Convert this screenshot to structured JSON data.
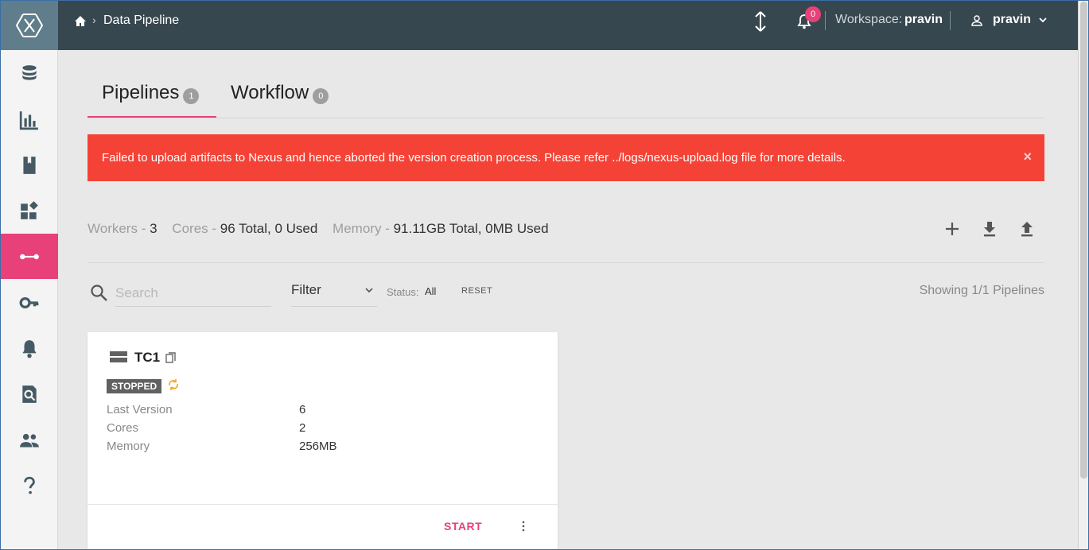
{
  "header": {
    "breadcrumb_sep": "›",
    "breadcrumb": "Data Pipeline",
    "notification_count": "0",
    "workspace_label": "Workspace:",
    "workspace_value": "pravin",
    "user_name": "pravin"
  },
  "sidebar": {
    "items": [
      {
        "icon": "database-icon"
      },
      {
        "icon": "bar-chart-icon"
      },
      {
        "icon": "book-icon"
      },
      {
        "icon": "dashboard-widgets-icon"
      },
      {
        "icon": "pipeline-icon",
        "active": true
      },
      {
        "icon": "key-icon"
      },
      {
        "icon": "bell-icon"
      },
      {
        "icon": "search-document-icon"
      },
      {
        "icon": "people-icon"
      },
      {
        "icon": "help-icon"
      }
    ]
  },
  "tabs": [
    {
      "label": "Pipelines",
      "count": "1",
      "active": true
    },
    {
      "label": "Workflow",
      "count": "0",
      "active": false
    }
  ],
  "error": {
    "message": "Failed to upload artifacts to Nexus and hence aborted the version creation process. Please refer ../logs/nexus-upload.log file for more details.",
    "close": "×"
  },
  "stats": {
    "workers_label": "Workers -",
    "workers_value": "3",
    "cores_label": "Cores -",
    "cores_value": "96 Total, 0 Used",
    "memory_label": "Memory -",
    "memory_value": "91.11GB Total, 0MB Used"
  },
  "filters": {
    "search_placeholder": "Search",
    "filter_label": "Filter",
    "status_label": "Status:",
    "status_value": "All",
    "reset_label": "RESET",
    "showing": "Showing 1/1 Pipelines"
  },
  "pipeline_card": {
    "name": "TC1",
    "status": "STOPPED",
    "fields": [
      {
        "key": "Last Version",
        "value": "6"
      },
      {
        "key": "Cores",
        "value": "2"
      },
      {
        "key": "Memory",
        "value": "256MB"
      }
    ],
    "start_label": "START"
  },
  "colors": {
    "accent": "#e8417a",
    "header_bg": "#37474f",
    "logo_bg": "#607d8b",
    "error_bg": "#f44336",
    "content_bg": "#e8e8e8"
  }
}
